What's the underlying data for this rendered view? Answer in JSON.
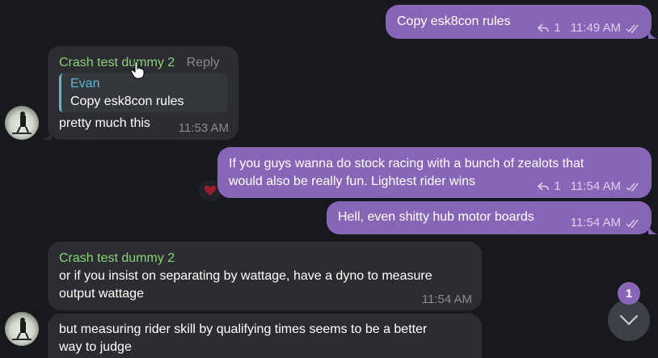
{
  "messages": [
    {
      "id": "m1",
      "text": "Copy esk8con rules",
      "reply_count": "1",
      "time": "11:49 AM"
    },
    {
      "id": "m2",
      "sender": "Crash test dummy 2",
      "reply_label": "Reply",
      "quote_name": "Evan",
      "quote_text": "Copy esk8con rules",
      "text": "pretty much this",
      "time": "11:53 AM"
    },
    {
      "id": "m3",
      "text_line1": "If you guys wanna do stock racing with a bunch of zealots that",
      "text_line2": "would also be really fun. Lightest rider wins",
      "reply_count": "1",
      "time": "11:54 AM"
    },
    {
      "id": "m4",
      "text": "Hell, even shitty hub motor boards",
      "time": "11:54 AM"
    },
    {
      "id": "m5",
      "sender": "Crash test dummy 2",
      "text_line1": "or if you insist on separating by wattage, have a dyno to measure",
      "text_line2": "output wattage",
      "time": "11:54 AM"
    },
    {
      "id": "m6",
      "text_line1": "but measuring rider skill by qualifying times seems to be a better",
      "text_line2": "way to judge"
    }
  ],
  "scroll": {
    "unread_count": "1",
    "icon": "chevron-down-icon"
  },
  "colors": {
    "outgoing": "#8866b7",
    "incoming": "#2b2d31",
    "sender": "#8ad27a",
    "quote_accent": "#5fb4d8",
    "background": "#17191d"
  }
}
